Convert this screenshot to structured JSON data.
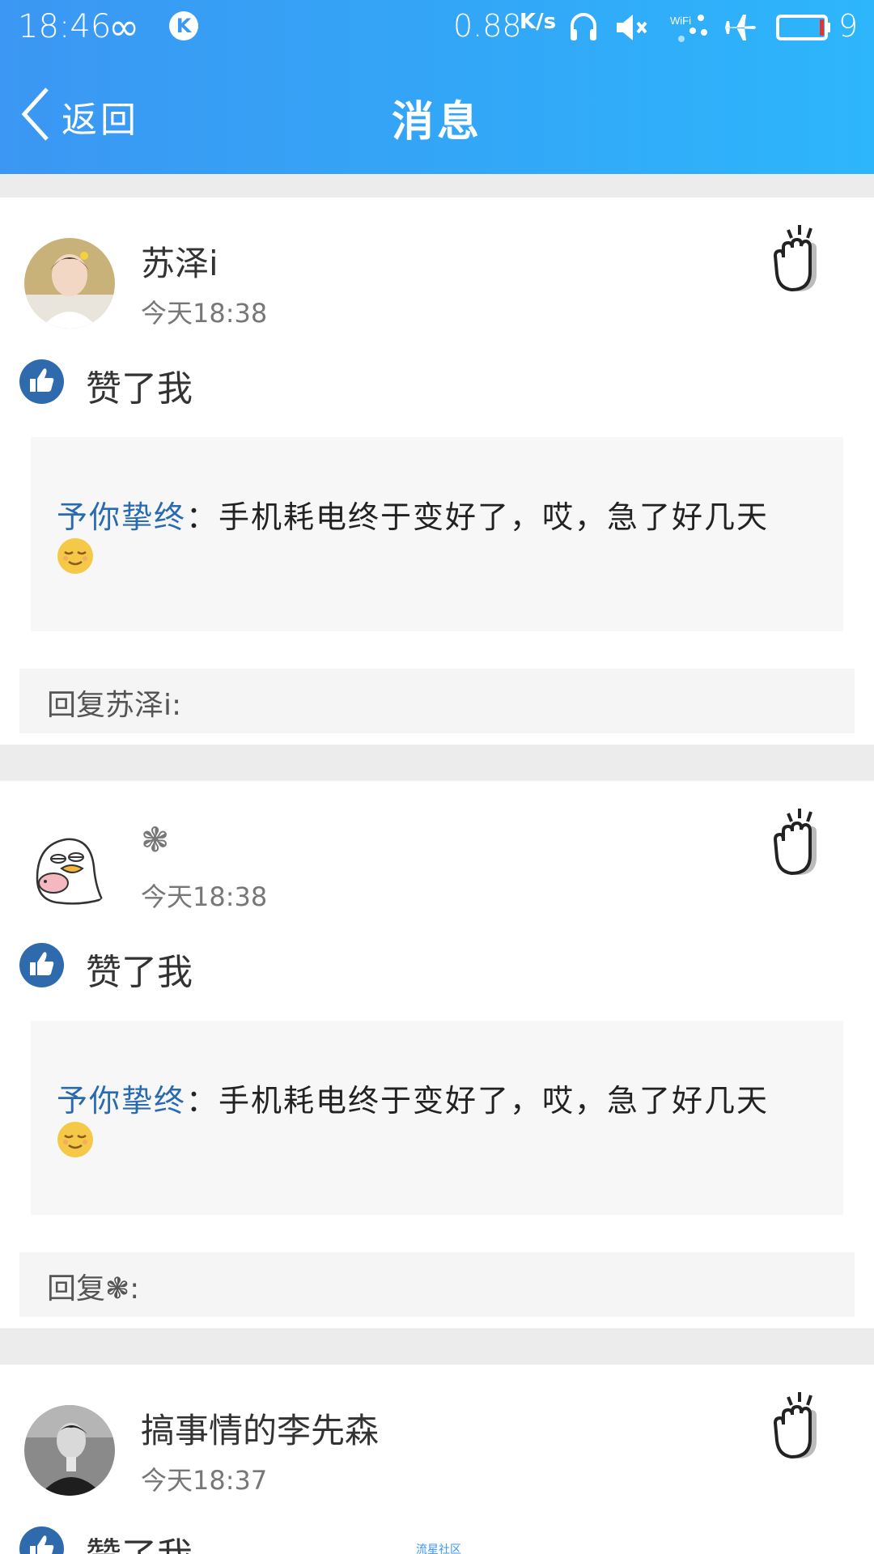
{
  "status_bar": {
    "time": "18:46",
    "infinity_glyph": "∞",
    "k_badge": "K",
    "speed_value": "0.88",
    "speed_unit": "K/s",
    "battery_level": "9",
    "icons": [
      "infinity-icon",
      "k-app-icon",
      "headphones-icon",
      "mute-icon",
      "wifi-icon",
      "airplane-icon",
      "battery-icon"
    ]
  },
  "nav": {
    "back_label": "返回",
    "title": "消息"
  },
  "messages": [
    {
      "user": "苏泽i",
      "time": "今天18:38",
      "action": "赞了我",
      "quote_author": "予你挚终",
      "quote_sep": "：",
      "quote_text": "手机耗电终于变好了，哎，急了好几天",
      "reply_label": "回复苏泽i:"
    },
    {
      "user": "❃",
      "time": "今天18:38",
      "action": "赞了我",
      "quote_author": "予你挚终",
      "quote_sep": "：",
      "quote_text": "手机耗电终于变好了，哎，急了好几天",
      "reply_label": "回复❃:"
    },
    {
      "user": "搞事情的李先森",
      "time": "今天18:37",
      "action": "赞了我"
    }
  ],
  "watermark": "流星社区",
  "colors": {
    "header_start": "#3b97f3",
    "header_end": "#2db6fb",
    "like_badge": "#2f6aad",
    "quote_author": "#2a6bb0",
    "page_bg": "#ececec"
  }
}
